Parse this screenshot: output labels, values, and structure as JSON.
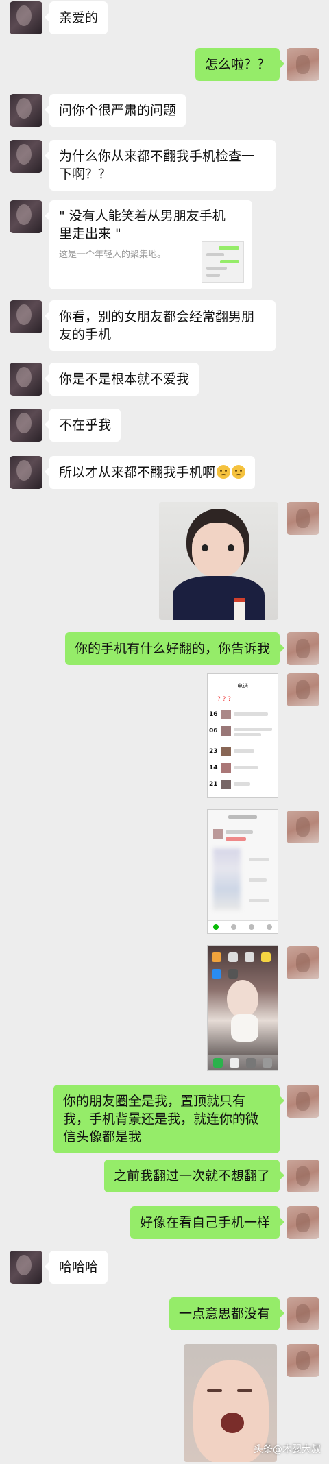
{
  "messages": [
    {
      "side": "left",
      "text": "亲爱的"
    },
    {
      "side": "right",
      "text": "怎么啦？？"
    },
    {
      "side": "left",
      "text": "问你个很严肃的问题"
    },
    {
      "side": "left",
      "text": "为什么你从来都不翻我手机检查一下啊？？"
    },
    {
      "side": "left",
      "type": "link",
      "title": "\" 没有人能笑着从男朋友手机里走出来 \"",
      "desc": "这是一个年轻人的聚集地。"
    },
    {
      "side": "left",
      "text": "你看，别的女朋友都会经常翻男朋友的手机"
    },
    {
      "side": "left",
      "text": "你是不是根本就不爱我"
    },
    {
      "side": "left",
      "text": "不在乎我"
    },
    {
      "side": "left",
      "text": "所以才从来都不翻我手机啊"
    },
    {
      "side": "right",
      "text": "你的手机有什么好翻的，你告诉我"
    },
    {
      "side": "right",
      "text": "你的朋友圈全是我，置顶就只有我，手机背景还是我，就连你的微信头像都是我"
    },
    {
      "side": "right",
      "text": "之前我翻过一次就不想翻了"
    },
    {
      "side": "right",
      "text": "好像在看自己手机一样"
    },
    {
      "side": "left",
      "text": "哈哈哈"
    },
    {
      "side": "right",
      "text": "一点意思都没有"
    }
  ],
  "screenshots": {
    "contacts": {
      "header": "电话",
      "items": [
        {
          "day": "16"
        },
        {
          "day": "06"
        },
        {
          "day": "23"
        },
        {
          "day": "14"
        },
        {
          "day": "21"
        }
      ]
    }
  },
  "watermark": "头条@木婴大叔",
  "colors": {
    "bg": "#ededed",
    "me": "#95ec69",
    "her": "#ffffff"
  }
}
